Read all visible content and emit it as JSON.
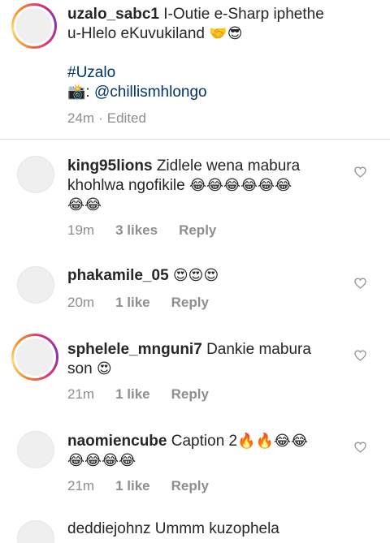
{
  "caption": {
    "username": "uzalo_sabc1",
    "text_line1": "I-Outie e-Sharp iphethe",
    "text_line2": "u-Hlelo eKuvukiland",
    "emojis_line2": "🤝😎",
    "hashtag": "#Uzalo",
    "camera_emoji": "📸",
    "mention_prefix": ": ",
    "mention": "@chillismhlongo",
    "time": "24m",
    "separator": "·",
    "edited": "Edited"
  },
  "comments": [
    {
      "username": "king95lions",
      "text_line1": "Zidlele wena mabura",
      "text_line2": "khohlwa ngofikile",
      "emojis_line2": "😂😂😂😂😂😂",
      "emojis_line3": "😂😂",
      "time": "19m",
      "likes": "3 likes",
      "reply": "Reply"
    },
    {
      "username": "phakamile_05",
      "emojis": "😍😍😍",
      "time": "20m",
      "likes": "1 like",
      "reply": "Reply"
    },
    {
      "username": "sphelele_mnguni7",
      "text_line1": "Dankie mabura",
      "text_line2": "son",
      "emojis_line2": "😍",
      "time": "21m",
      "likes": "1 like",
      "reply": "Reply"
    },
    {
      "username": "naomiencube",
      "text_line1": "Caption 2",
      "emojis_line1": "🔥🔥😂😂",
      "emojis_line2": "😂😂😂😂",
      "time": "21m",
      "likes": "1 like",
      "reply": "Reply"
    }
  ],
  "partial_comment": {
    "text": "deddiejohnz Ummm kuzophela"
  },
  "icons": {
    "heart": "heart-outline-icon",
    "camera": "camera-emoji"
  },
  "colors": {
    "link": "#003569",
    "meta": "#8e8e8e",
    "divider": "#dbdbdb"
  }
}
